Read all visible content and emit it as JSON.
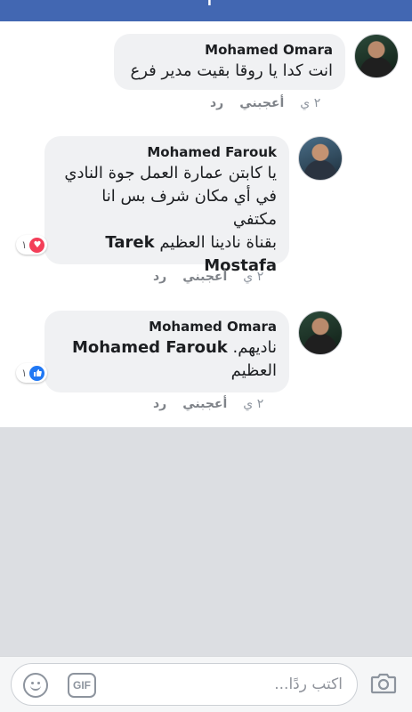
{
  "topbar": {
    "glyph": "ا"
  },
  "comments": [
    {
      "author": "Mohamed Omara",
      "text": "انت كدا يا روقا بقيت مدير فرع",
      "time": "٢ ي",
      "like_label": "أعجبني",
      "reply_label": "رد"
    },
    {
      "author": "Mohamed Farouk",
      "text_lines": [
        "يا كابتن عمارة العمل جوة النادي",
        "في أي مكان شرف بس انا مكتفي"
      ],
      "text_last": "بقناة نادينا العظيم",
      "mention": "Tarek Mostafa",
      "time": "٢ ي",
      "like_label": "أعجبني",
      "reply_label": "رد",
      "reaction_count": "١",
      "reaction_type": "heart"
    },
    {
      "author": "Mohamed Omara",
      "mention": "Mohamed Farouk",
      "text_a": "ناديهم.",
      "text_b": "العظيم",
      "time": "٢ ي",
      "like_label": "أعجبني",
      "reply_label": "رد",
      "reaction_count": "١",
      "reaction_type": "like"
    }
  ],
  "composer": {
    "placeholder": "اكتب ردًا...",
    "gif_label": "GIF",
    "icons": [
      "emoji-icon",
      "gif-icon",
      "camera-icon"
    ]
  },
  "colors": {
    "header": "#4267b2",
    "bubble": "#f0f1f3",
    "heart": "#f33e58",
    "like": "#2078f4"
  }
}
